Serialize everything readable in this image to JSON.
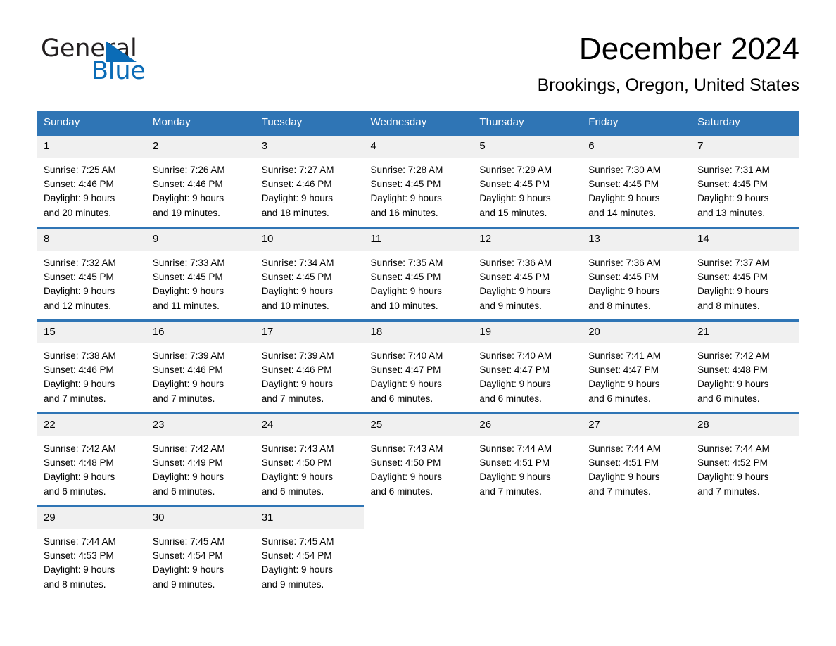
{
  "brand": {
    "name_part1": "General",
    "name_part2": "Blue",
    "triangle_icon": "triangle-icon",
    "accent_color": "#0b6cb7"
  },
  "header": {
    "month_title": "December 2024",
    "location": "Brookings, Oregon, United States"
  },
  "theme": {
    "header_blue": "#2f75b5",
    "daynum_band": "#f0f0f0",
    "text": "#000000"
  },
  "calendar": {
    "weekday_headers": [
      "Sunday",
      "Monday",
      "Tuesday",
      "Wednesday",
      "Thursday",
      "Friday",
      "Saturday"
    ],
    "weeks": [
      [
        {
          "day": "1",
          "sunrise": "Sunrise: 7:25 AM",
          "sunset": "Sunset: 4:46 PM",
          "daylight_1": "Daylight: 9 hours",
          "daylight_2": "and 20 minutes."
        },
        {
          "day": "2",
          "sunrise": "Sunrise: 7:26 AM",
          "sunset": "Sunset: 4:46 PM",
          "daylight_1": "Daylight: 9 hours",
          "daylight_2": "and 19 minutes."
        },
        {
          "day": "3",
          "sunrise": "Sunrise: 7:27 AM",
          "sunset": "Sunset: 4:46 PM",
          "daylight_1": "Daylight: 9 hours",
          "daylight_2": "and 18 minutes."
        },
        {
          "day": "4",
          "sunrise": "Sunrise: 7:28 AM",
          "sunset": "Sunset: 4:45 PM",
          "daylight_1": "Daylight: 9 hours",
          "daylight_2": "and 16 minutes."
        },
        {
          "day": "5",
          "sunrise": "Sunrise: 7:29 AM",
          "sunset": "Sunset: 4:45 PM",
          "daylight_1": "Daylight: 9 hours",
          "daylight_2": "and 15 minutes."
        },
        {
          "day": "6",
          "sunrise": "Sunrise: 7:30 AM",
          "sunset": "Sunset: 4:45 PM",
          "daylight_1": "Daylight: 9 hours",
          "daylight_2": "and 14 minutes."
        },
        {
          "day": "7",
          "sunrise": "Sunrise: 7:31 AM",
          "sunset": "Sunset: 4:45 PM",
          "daylight_1": "Daylight: 9 hours",
          "daylight_2": "and 13 minutes."
        }
      ],
      [
        {
          "day": "8",
          "sunrise": "Sunrise: 7:32 AM",
          "sunset": "Sunset: 4:45 PM",
          "daylight_1": "Daylight: 9 hours",
          "daylight_2": "and 12 minutes."
        },
        {
          "day": "9",
          "sunrise": "Sunrise: 7:33 AM",
          "sunset": "Sunset: 4:45 PM",
          "daylight_1": "Daylight: 9 hours",
          "daylight_2": "and 11 minutes."
        },
        {
          "day": "10",
          "sunrise": "Sunrise: 7:34 AM",
          "sunset": "Sunset: 4:45 PM",
          "daylight_1": "Daylight: 9 hours",
          "daylight_2": "and 10 minutes."
        },
        {
          "day": "11",
          "sunrise": "Sunrise: 7:35 AM",
          "sunset": "Sunset: 4:45 PM",
          "daylight_1": "Daylight: 9 hours",
          "daylight_2": "and 10 minutes."
        },
        {
          "day": "12",
          "sunrise": "Sunrise: 7:36 AM",
          "sunset": "Sunset: 4:45 PM",
          "daylight_1": "Daylight: 9 hours",
          "daylight_2": "and 9 minutes."
        },
        {
          "day": "13",
          "sunrise": "Sunrise: 7:36 AM",
          "sunset": "Sunset: 4:45 PM",
          "daylight_1": "Daylight: 9 hours",
          "daylight_2": "and 8 minutes."
        },
        {
          "day": "14",
          "sunrise": "Sunrise: 7:37 AM",
          "sunset": "Sunset: 4:45 PM",
          "daylight_1": "Daylight: 9 hours",
          "daylight_2": "and 8 minutes."
        }
      ],
      [
        {
          "day": "15",
          "sunrise": "Sunrise: 7:38 AM",
          "sunset": "Sunset: 4:46 PM",
          "daylight_1": "Daylight: 9 hours",
          "daylight_2": "and 7 minutes."
        },
        {
          "day": "16",
          "sunrise": "Sunrise: 7:39 AM",
          "sunset": "Sunset: 4:46 PM",
          "daylight_1": "Daylight: 9 hours",
          "daylight_2": "and 7 minutes."
        },
        {
          "day": "17",
          "sunrise": "Sunrise: 7:39 AM",
          "sunset": "Sunset: 4:46 PM",
          "daylight_1": "Daylight: 9 hours",
          "daylight_2": "and 7 minutes."
        },
        {
          "day": "18",
          "sunrise": "Sunrise: 7:40 AM",
          "sunset": "Sunset: 4:47 PM",
          "daylight_1": "Daylight: 9 hours",
          "daylight_2": "and 6 minutes."
        },
        {
          "day": "19",
          "sunrise": "Sunrise: 7:40 AM",
          "sunset": "Sunset: 4:47 PM",
          "daylight_1": "Daylight: 9 hours",
          "daylight_2": "and 6 minutes."
        },
        {
          "day": "20",
          "sunrise": "Sunrise: 7:41 AM",
          "sunset": "Sunset: 4:47 PM",
          "daylight_1": "Daylight: 9 hours",
          "daylight_2": "and 6 minutes."
        },
        {
          "day": "21",
          "sunrise": "Sunrise: 7:42 AM",
          "sunset": "Sunset: 4:48 PM",
          "daylight_1": "Daylight: 9 hours",
          "daylight_2": "and 6 minutes."
        }
      ],
      [
        {
          "day": "22",
          "sunrise": "Sunrise: 7:42 AM",
          "sunset": "Sunset: 4:48 PM",
          "daylight_1": "Daylight: 9 hours",
          "daylight_2": "and 6 minutes."
        },
        {
          "day": "23",
          "sunrise": "Sunrise: 7:42 AM",
          "sunset": "Sunset: 4:49 PM",
          "daylight_1": "Daylight: 9 hours",
          "daylight_2": "and 6 minutes."
        },
        {
          "day": "24",
          "sunrise": "Sunrise: 7:43 AM",
          "sunset": "Sunset: 4:50 PM",
          "daylight_1": "Daylight: 9 hours",
          "daylight_2": "and 6 minutes."
        },
        {
          "day": "25",
          "sunrise": "Sunrise: 7:43 AM",
          "sunset": "Sunset: 4:50 PM",
          "daylight_1": "Daylight: 9 hours",
          "daylight_2": "and 6 minutes."
        },
        {
          "day": "26",
          "sunrise": "Sunrise: 7:44 AM",
          "sunset": "Sunset: 4:51 PM",
          "daylight_1": "Daylight: 9 hours",
          "daylight_2": "and 7 minutes."
        },
        {
          "day": "27",
          "sunrise": "Sunrise: 7:44 AM",
          "sunset": "Sunset: 4:51 PM",
          "daylight_1": "Daylight: 9 hours",
          "daylight_2": "and 7 minutes."
        },
        {
          "day": "28",
          "sunrise": "Sunrise: 7:44 AM",
          "sunset": "Sunset: 4:52 PM",
          "daylight_1": "Daylight: 9 hours",
          "daylight_2": "and 7 minutes."
        }
      ],
      [
        {
          "day": "29",
          "sunrise": "Sunrise: 7:44 AM",
          "sunset": "Sunset: 4:53 PM",
          "daylight_1": "Daylight: 9 hours",
          "daylight_2": "and 8 minutes."
        },
        {
          "day": "30",
          "sunrise": "Sunrise: 7:45 AM",
          "sunset": "Sunset: 4:54 PM",
          "daylight_1": "Daylight: 9 hours",
          "daylight_2": "and 9 minutes."
        },
        {
          "day": "31",
          "sunrise": "Sunrise: 7:45 AM",
          "sunset": "Sunset: 4:54 PM",
          "daylight_1": "Daylight: 9 hours",
          "daylight_2": "and 9 minutes."
        },
        {
          "day": "",
          "sunrise": "",
          "sunset": "",
          "daylight_1": "",
          "daylight_2": ""
        },
        {
          "day": "",
          "sunrise": "",
          "sunset": "",
          "daylight_1": "",
          "daylight_2": ""
        },
        {
          "day": "",
          "sunrise": "",
          "sunset": "",
          "daylight_1": "",
          "daylight_2": ""
        },
        {
          "day": "",
          "sunrise": "",
          "sunset": "",
          "daylight_1": "",
          "daylight_2": ""
        }
      ]
    ]
  }
}
